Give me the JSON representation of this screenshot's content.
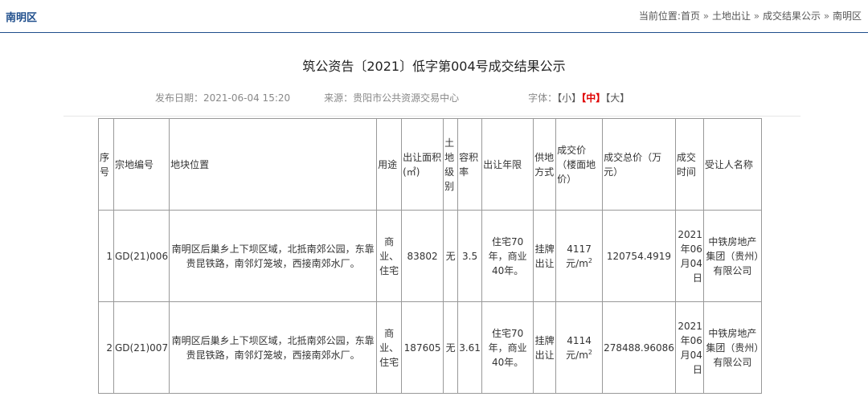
{
  "header": {
    "region": "南明区",
    "breadcrumb": {
      "prefix": "当前位置:",
      "items": [
        "首页",
        "土地出让",
        "成交结果公示",
        "南明区"
      ],
      "separator": "»"
    }
  },
  "article": {
    "title": "筑公资告〔2021〕低字第004号成交结果公示",
    "publish_date": "发布日期：2021-06-04 15:20",
    "source": "来源：贵阳市公共资源交易中心",
    "font_label": "字体：",
    "font_sizes": [
      "【小】",
      "【中】",
      "【大】"
    ],
    "font_size_selected": "【中】"
  },
  "table": {
    "headers": [
      "序号",
      "宗地编号",
      "地块位置",
      "用途",
      "出让面积(㎡)",
      "土地级别",
      "容积率",
      "出让年限",
      "供地方式",
      "成交价（楼面地价）",
      "成交总价（万元）",
      "成交时间",
      "受让人名称"
    ],
    "rows": [
      {
        "no": "1",
        "code": "GD(21)006",
        "location": "南明区后巢乡上下坝区域，北抵南郊公园，东靠贵昆铁路，南邻灯笼坡，西接南郊水厂。",
        "use": "商业、住宅",
        "area": "83802",
        "grade": "无",
        "far": "3.5",
        "term": "住宅70年，商业40年。",
        "method": "挂牌出让",
        "price": "4117",
        "price_unit": "元/m",
        "total": "120754.4919",
        "date": "2021年06月04日",
        "buyer": "中铁房地产集团（贵州）有限公司"
      },
      {
        "no": "2",
        "code": "GD(21)007",
        "location": "南明区后巢乡上下坝区域，北抵南郊公园，东靠贵昆铁路，南邻灯笼坡，西接南郊水厂。",
        "use": "商业、住宅",
        "area": "187605",
        "grade": "无",
        "far": "3.61",
        "term": "住宅70年，商业40年。",
        "method": "挂牌出让",
        "price": "4114",
        "price_unit": "元/m",
        "total": "278488.96086",
        "date": "2021年06月04日",
        "buyer": "中铁房地产集团（贵州）有限公司"
      }
    ]
  }
}
